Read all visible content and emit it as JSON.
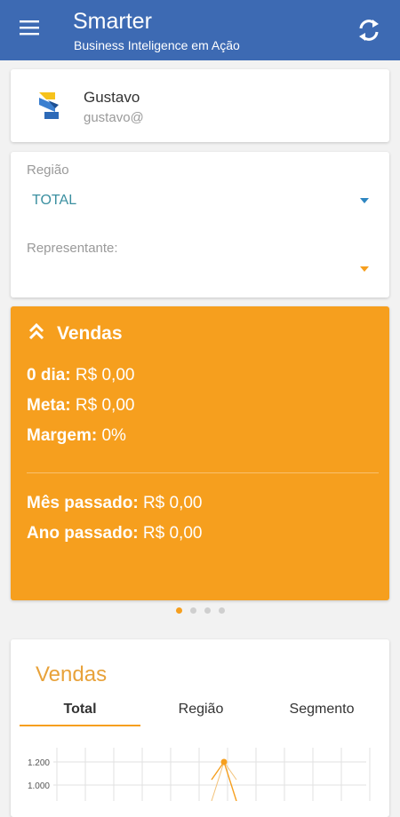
{
  "appbar": {
    "title": "Smarter",
    "subtitle": "Business Inteligence em Ação",
    "menu_icon": "hamburger-menu-icon",
    "refresh_icon": "refresh-icon",
    "color": "#3d6ab3"
  },
  "user": {
    "name": "Gustavo",
    "email": "gustavo@",
    "logo": "company-logo"
  },
  "filters": {
    "region_label": "Região",
    "region_value": "TOTAL",
    "region_caret_color": "#2e86c1",
    "rep_label": "Representante:",
    "rep_value": "",
    "rep_caret_color": "#f69f1e"
  },
  "sales": {
    "title": "Vendas",
    "color": "#f69f1e",
    "day_label": "0 dia:",
    "day_value": "R$ 0,00",
    "goal_label": "Meta:",
    "goal_value": "R$ 0,00",
    "margin_label": "Margem:",
    "margin_value": "0%",
    "last_month_label": "Mês passado:",
    "last_month_value": "R$ 0,00",
    "last_year_label": "Ano passado:",
    "last_year_value": "R$ 0,00"
  },
  "pager": {
    "count": 4,
    "active": 0
  },
  "chart_section": {
    "title": "Vendas",
    "tabs": [
      "Total",
      "Região",
      "Segmento"
    ],
    "active_tab": 0
  },
  "chart_data": {
    "type": "line",
    "y_ticks": [
      "1.200",
      "1.000"
    ],
    "point_value": 1200,
    "grid": true,
    "color": "#f69f1e"
  }
}
